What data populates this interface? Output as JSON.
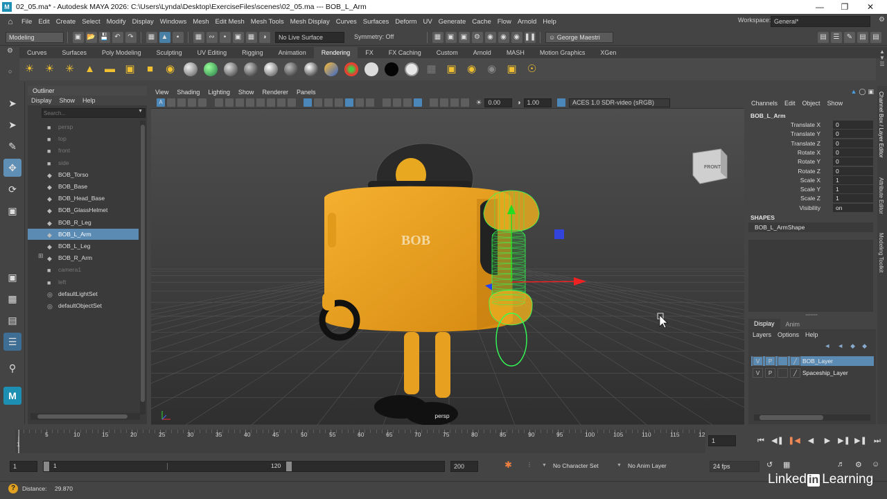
{
  "titlebar": {
    "title": "02_05.ma* - Autodesk MAYA 2026: C:\\Users\\Lynda\\Desktop\\ExerciseFiles\\scenes\\02_05.ma  ---  BOB_L_Arm",
    "logo": "M"
  },
  "menubar": {
    "items": [
      "File",
      "Edit",
      "Create",
      "Select",
      "Modify",
      "Display",
      "Windows",
      "Mesh",
      "Edit Mesh",
      "Mesh Tools",
      "Mesh Display",
      "Curves",
      "Surfaces",
      "Deform",
      "UV",
      "Generate",
      "Cache",
      "Flow",
      "Arnold",
      "Help"
    ],
    "workspace_label": "Workspace:",
    "workspace_value": "General*"
  },
  "statusline": {
    "mode": "Modeling",
    "live_surface": "No Live Surface",
    "symmetry": "Symmetry: Off",
    "user": "George Maestri"
  },
  "shelf": {
    "tabs": [
      "Curves",
      "Surfaces",
      "Poly Modeling",
      "Sculpting",
      "UV Editing",
      "Rigging",
      "Animation",
      "Rendering",
      "FX",
      "FX Caching",
      "Custom",
      "Arnold",
      "MASH",
      "Motion Graphics",
      "XGen"
    ],
    "active_tab": "Rendering"
  },
  "outliner": {
    "title": "Outliner",
    "menus": [
      "Display",
      "Show",
      "Help"
    ],
    "search_placeholder": "Search...",
    "items": [
      {
        "label": "persp",
        "dim": true,
        "icon": "camera-icon"
      },
      {
        "label": "top",
        "dim": true,
        "icon": "camera-icon"
      },
      {
        "label": "front",
        "dim": true,
        "icon": "camera-icon"
      },
      {
        "label": "side",
        "dim": true,
        "icon": "camera-icon"
      },
      {
        "label": "BOB_Torso",
        "dim": false,
        "icon": "mesh-icon"
      },
      {
        "label": "BOB_Base",
        "dim": false,
        "icon": "mesh-icon"
      },
      {
        "label": "BOB_Head_Base",
        "dim": false,
        "icon": "mesh-icon"
      },
      {
        "label": "BOB_GlassHelmet",
        "dim": false,
        "icon": "mesh-icon"
      },
      {
        "label": "BOB_R_Leg",
        "dim": false,
        "icon": "mesh-icon"
      },
      {
        "label": "BOB_L_Arm",
        "dim": false,
        "icon": "mesh-icon",
        "selected": true
      },
      {
        "label": "BOB_L_Leg",
        "dim": false,
        "icon": "mesh-icon"
      },
      {
        "label": "BOB_R_Arm",
        "dim": false,
        "icon": "mesh-icon"
      },
      {
        "label": "camera1",
        "dim": true,
        "icon": "camera-icon"
      },
      {
        "label": "left",
        "dim": true,
        "icon": "camera-icon"
      },
      {
        "label": "defaultLightSet",
        "dim": false,
        "icon": "set-icon"
      },
      {
        "label": "defaultObjectSet",
        "dim": false,
        "icon": "set-icon"
      }
    ]
  },
  "viewport": {
    "menus": [
      "View",
      "Shading",
      "Lighting",
      "Show",
      "Renderer",
      "Panels"
    ],
    "exposure": "0.00",
    "gamma": "1.00",
    "color_space": "ACES 1.0 SDR-video (sRGB)",
    "camera_label": "persp",
    "viewcube_label": "FRONT",
    "model_text": "BOB"
  },
  "channelbox": {
    "menus": [
      "Channels",
      "Edit",
      "Object",
      "Show"
    ],
    "object": "BOB_L_Arm",
    "channels": [
      {
        "label": "Translate X",
        "value": "0"
      },
      {
        "label": "Translate Y",
        "value": "0"
      },
      {
        "label": "Translate Z",
        "value": "0"
      },
      {
        "label": "Rotate X",
        "value": "0"
      },
      {
        "label": "Rotate Y",
        "value": "0"
      },
      {
        "label": "Rotate Z",
        "value": "0"
      },
      {
        "label": "Scale X",
        "value": "1"
      },
      {
        "label": "Scale Y",
        "value": "1"
      },
      {
        "label": "Scale Z",
        "value": "1"
      },
      {
        "label": "Visibility",
        "value": "on"
      }
    ],
    "shapes_header": "SHAPES",
    "shape": "BOB_L_ArmShape"
  },
  "sidetabs": [
    "Channel Box / Layer Editor",
    "Attribute Editor",
    "Modeling Toolkit"
  ],
  "layers": {
    "tabs": [
      "Display",
      "Anim"
    ],
    "menus": [
      "Layers",
      "Options",
      "Help"
    ],
    "rows": [
      {
        "v": "V",
        "p": "P",
        "name": "BOB_Layer",
        "selected": true
      },
      {
        "v": "V",
        "p": "P",
        "name": "Spaceship_Layer",
        "selected": false
      }
    ]
  },
  "timeline": {
    "ticks": [
      "1",
      "5",
      "10",
      "15",
      "20",
      "25",
      "30",
      "35",
      "40",
      "45",
      "50",
      "55",
      "60",
      "65",
      "70",
      "75",
      "80",
      "85",
      "90",
      "95",
      "100",
      "105",
      "110",
      "115",
      "12"
    ],
    "current_frame": "1"
  },
  "range": {
    "start": "1",
    "range_start": "1",
    "range_end": "120",
    "end": "200",
    "character_set": "No Character Set",
    "anim_layer": "No Anim Layer",
    "fps": "24 fps"
  },
  "helpline": {
    "label": "Distance:",
    "value": "29.870",
    "brand": "Linked",
    "brand_in": "in",
    "brand_suffix": "Learning"
  }
}
